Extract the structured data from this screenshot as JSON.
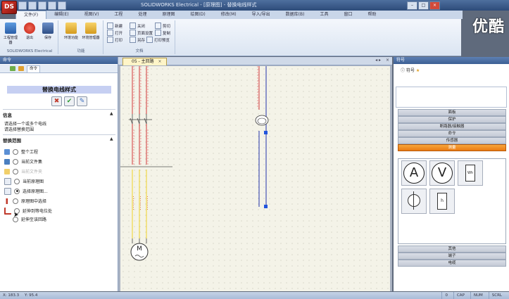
{
  "app": {
    "logo": "DS",
    "window_title": "SOLIDWORKS Electrical - [原理图] - 替换电线样式",
    "watermark": "优酷"
  },
  "ribbon": {
    "tabs": [
      "文件(F)",
      "编辑(E)",
      "视图(V)",
      "工程",
      "处理",
      "原理图",
      "绘图(D)",
      "修改(M)",
      "导入/导出",
      "数据库(B)",
      "工具",
      "窗口",
      "帮助"
    ],
    "groups": [
      {
        "label": "SOLIDWORKS Electrical",
        "buttons": [
          "工程管理器",
          "退出",
          "保存"
        ]
      },
      {
        "label": "功能",
        "buttons": [
          "环境功能",
          "环境管理器"
        ]
      },
      {
        "label": "文档",
        "items": [
          "新建",
          "打开",
          "打印",
          "关闭",
          "页面设置",
          "另存",
          "剪切",
          "复制",
          "打印预览"
        ]
      }
    ]
  },
  "left_panel": {
    "header": "命令",
    "tab_label": "命令",
    "command_title": "替换电线样式",
    "info_heading": "信息",
    "info_lines": [
      "请选择一个或多个电线",
      "请选择替换范围"
    ],
    "scope_heading": "替换范围",
    "scope_options": [
      {
        "label": "整个工程",
        "checked": false,
        "disabled": false
      },
      {
        "label": "当前文件集",
        "checked": false,
        "disabled": false
      },
      {
        "label": "当前文件夹",
        "checked": false,
        "disabled": true
      },
      {
        "label": "当前原理图",
        "checked": false,
        "disabled": false
      },
      {
        "label": "选择原理图...",
        "checked": true,
        "disabled": false
      },
      {
        "label": "原理图中选择",
        "checked": false,
        "disabled": false
      },
      {
        "label": "延伸到等电位处",
        "checked": false,
        "disabled": false
      },
      {
        "label": "延伸至该回路",
        "checked": false,
        "disabled": false
      }
    ]
  },
  "document": {
    "tab_label": "05 - 主回路"
  },
  "right_panel": {
    "header": "符号",
    "tab_label": "符号",
    "categories_top": [
      "面板",
      "保护",
      "断路器/接触器",
      "命令",
      "传感器",
      "测量"
    ],
    "categories_bottom": [
      "其他",
      "端子",
      "电缆"
    ],
    "active_category": "测量",
    "symbols": [
      "A",
      "V",
      "Wh",
      "",
      "h"
    ]
  },
  "status": {
    "cells": [
      "X: 183.3",
      "Y: 95.4",
      "0",
      "CAP",
      "NUM",
      "SCRL"
    ]
  }
}
